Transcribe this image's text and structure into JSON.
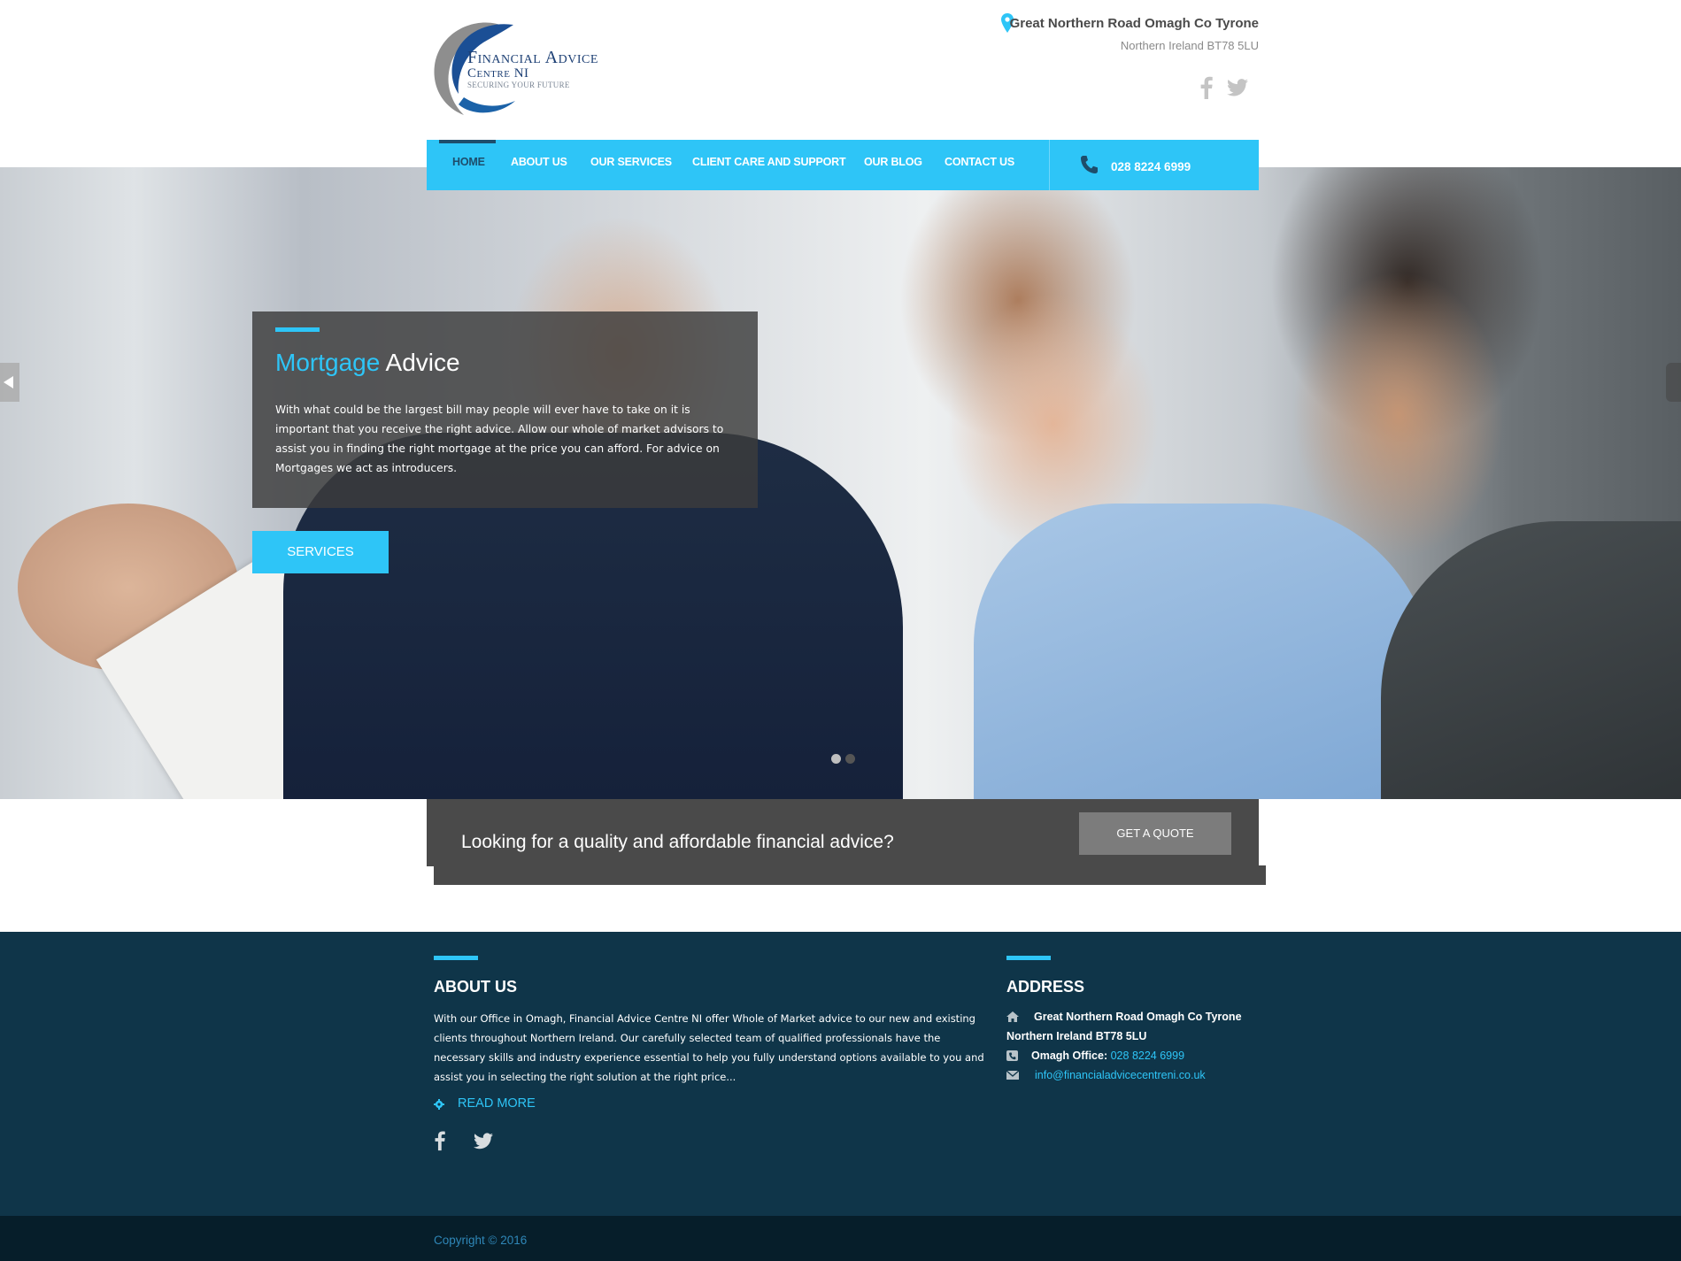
{
  "logo": {
    "line1": "Financial Advice",
    "line2": "Centre NI",
    "tagline": "Securing your future"
  },
  "header": {
    "address_line1": "Great Northern Road Omagh Co Tyrone",
    "address_line2": "Northern Ireland BT78 5LU",
    "social": [
      "facebook-icon",
      "twitter-icon"
    ]
  },
  "nav": {
    "items": [
      {
        "label": "HOME",
        "active": true
      },
      {
        "label": "ABOUT US",
        "active": false
      },
      {
        "label": "OUR SERVICES",
        "active": false
      },
      {
        "label": "CLIENT CARE AND SUPPORT",
        "active": false
      },
      {
        "label": "OUR BLOG",
        "active": false
      },
      {
        "label": "CONTACT US",
        "active": false
      }
    ],
    "phone": "028 8224 6999"
  },
  "slider": {
    "title_highlight": "Mortgage",
    "title_rest": "Advice",
    "text": "With what could be the largest bill may people will ever have to take on it is important that you receive the right advice. Allow our whole of market advisors to assist you in finding the right mortgage at the price you can afford. For advice on Mortgages we act as introducers.",
    "button": "SERVICES",
    "dots_total": 2,
    "active_dot": 2
  },
  "quote": {
    "text": "Looking for a quality and affordable financial advice?",
    "button": "GET A QUOTE"
  },
  "footer": {
    "about": {
      "heading": "ABOUT US",
      "text": "With our Office in Omagh, Financial Advice Centre NI offer Whole of Market advice to our new and existing clients throughout Northern Ireland. Our carefully selected team of qualified professionals have the necessary skills and industry experience essential to help you fully understand options available to you and assist you in selecting the right solution at the right price...",
      "read_more": "READ MORE"
    },
    "address": {
      "heading": "ADDRESS",
      "line1": "Great Northern Road Omagh Co Tyrone",
      "line2": "Northern Ireland BT78 5LU",
      "office_label": "Omagh Office:",
      "office_phone": "028 8224 6999",
      "email": "info@financialadvicecentreni.co.uk"
    },
    "copyright": "Copyright © 2016"
  },
  "colors": {
    "accent": "#2ec5f7",
    "footer_bg": "#0f3549",
    "copyright_bg": "#061e2a",
    "quote_bg": "#4a4a4a"
  }
}
